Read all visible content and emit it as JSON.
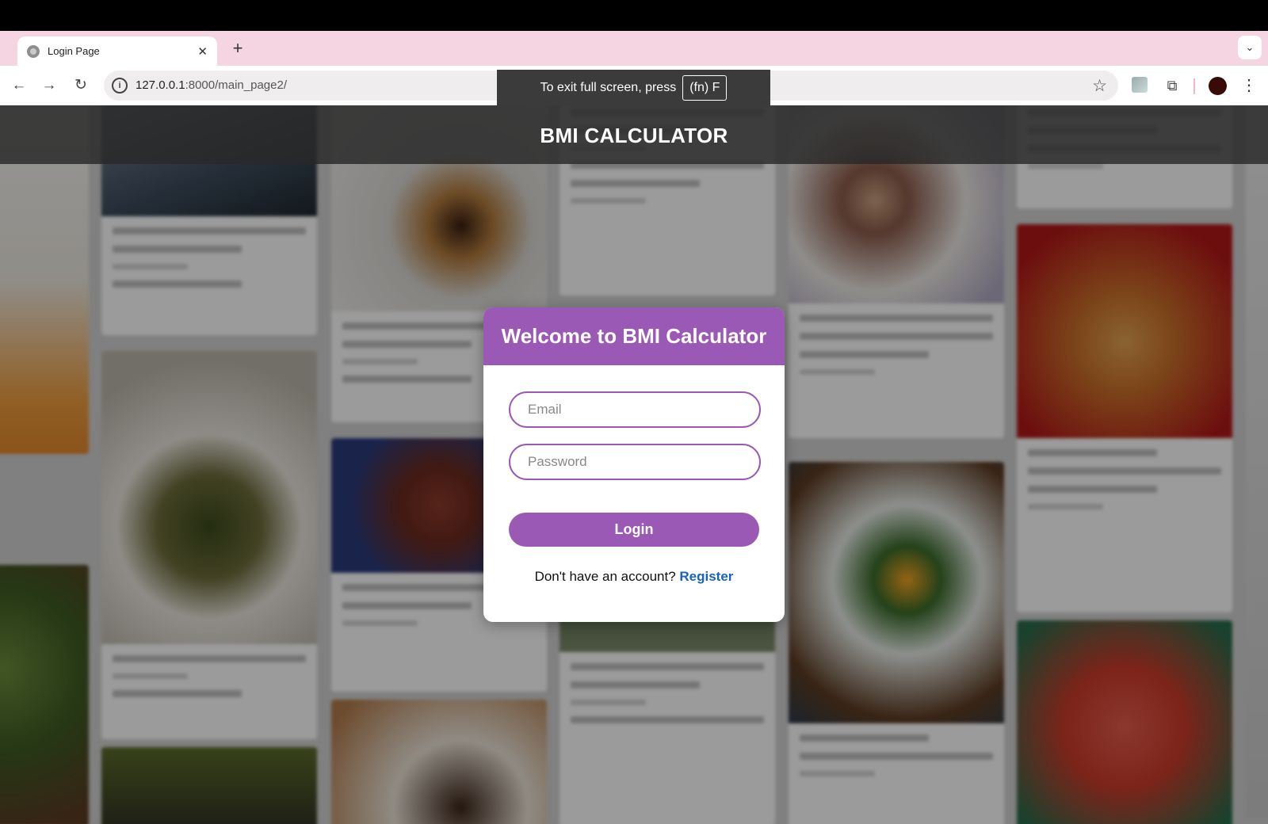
{
  "browser": {
    "tab": {
      "title": "Login Page",
      "close_glyph": "✕"
    },
    "new_tab_glyph": "+",
    "tab_menu_glyph": "⌄",
    "url_host": "127.0.0.1",
    "url_rest": ":8000/main_page2/",
    "fullscreen_notice": {
      "text": "To exit full screen, press",
      "key": "(fn) F"
    }
  },
  "app": {
    "header_title": "BMI CALCULATOR",
    "login": {
      "title": "Welcome to BMI Calculator",
      "email_placeholder": "Email",
      "password_placeholder": "Password",
      "login_label": "Login",
      "no_account_text": "Don't have an account?",
      "register_label": "Register"
    }
  },
  "colors": {
    "accent": "#9b59b6",
    "link": "#1565c0",
    "tabstrip": "#f6d5e3"
  },
  "icons": [
    "back-icon",
    "forward-icon",
    "reload-icon",
    "info-icon",
    "star-icon",
    "extension-icon",
    "profile-avatar",
    "menu-icon"
  ]
}
